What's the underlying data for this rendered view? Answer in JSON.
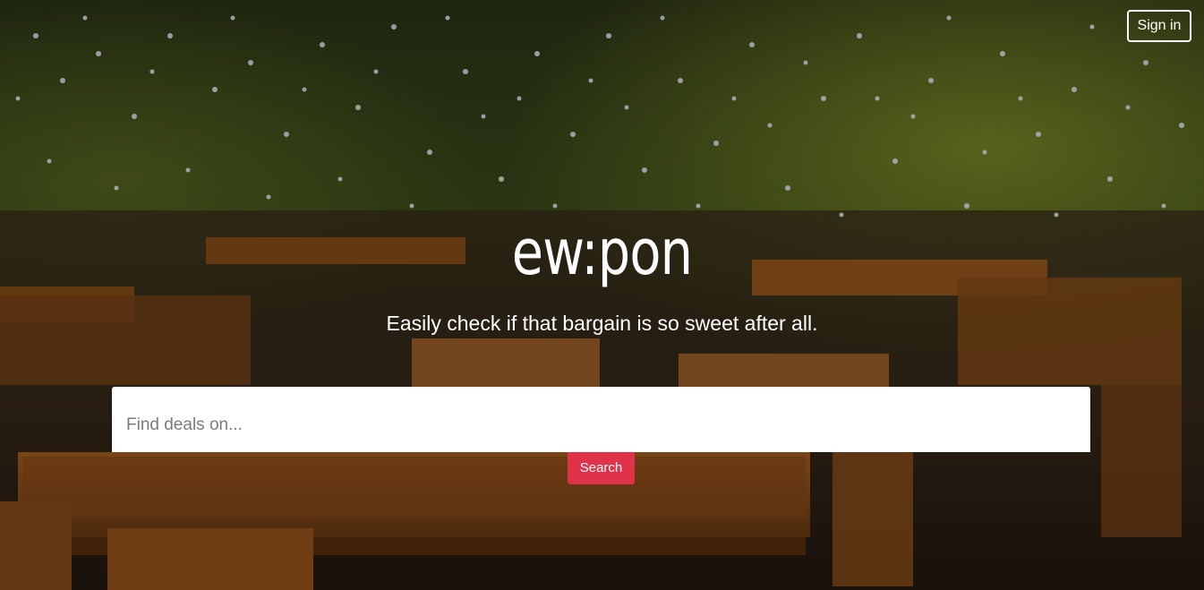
{
  "header": {
    "signin_label": "Sign in"
  },
  "hero": {
    "logo": "ew:pon",
    "tagline": "Easily check if that bargain is so sweet after all."
  },
  "search": {
    "placeholder": "Find deals on...",
    "value": "",
    "button_label": "Search"
  },
  "colors": {
    "accent": "#e0334a",
    "text": "#ffffff"
  }
}
